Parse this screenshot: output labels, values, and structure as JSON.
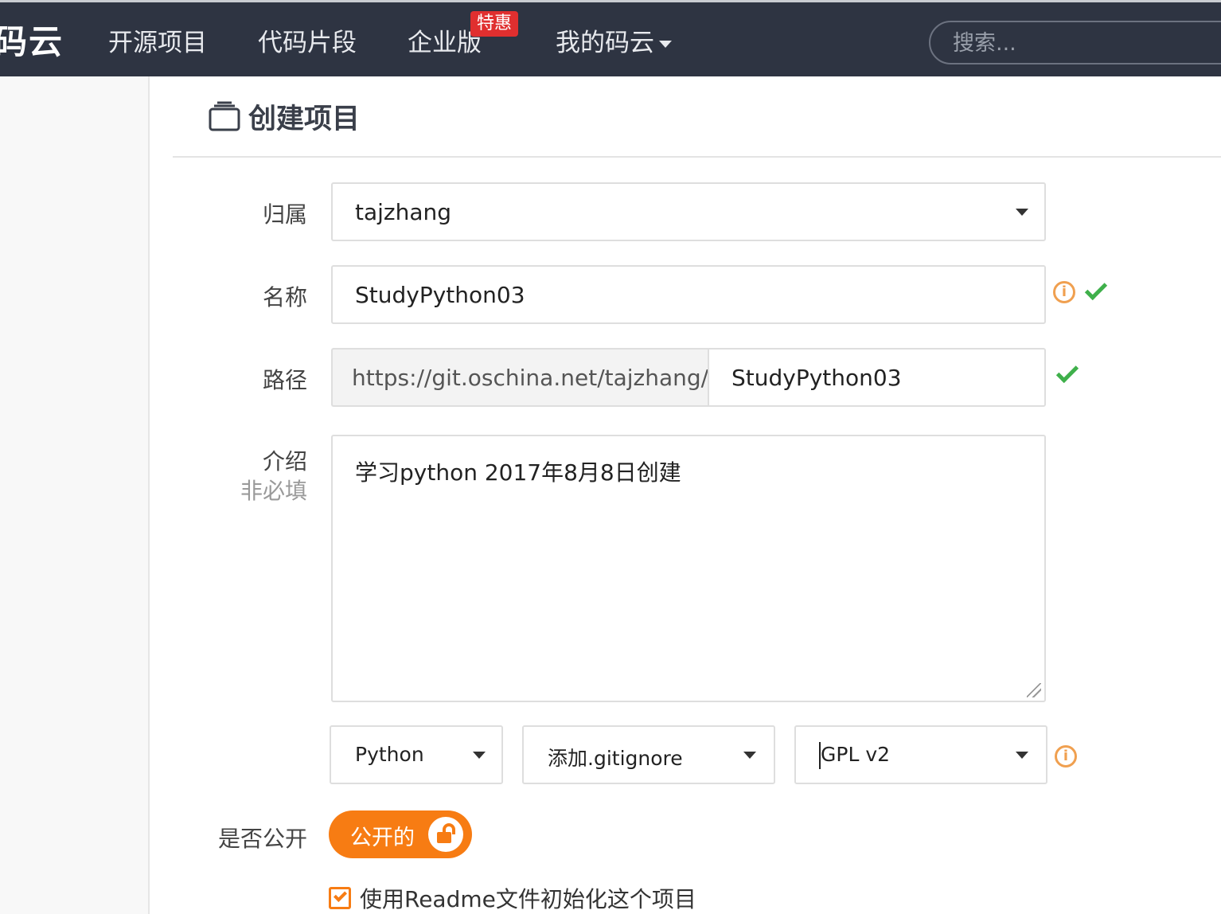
{
  "nav": {
    "logo": "码云",
    "items": [
      "开源项目",
      "代码片段",
      "企业版",
      "我的码云"
    ],
    "badge": "特惠",
    "search_placeholder": "搜索..."
  },
  "page": {
    "title": "创建项目"
  },
  "form": {
    "owner": {
      "label": "归属",
      "value": "tajzhang"
    },
    "name": {
      "label": "名称",
      "value": "StudyPython03"
    },
    "path": {
      "label": "路径",
      "prefix": "https://git.oschina.net/tajzhang/",
      "value": "StudyPython03"
    },
    "description": {
      "label": "介绍",
      "sublabel": "非必填",
      "value": "学习python 2017年8月8日创建"
    },
    "language": {
      "value": "Python"
    },
    "gitignore": {
      "value": "添加.gitignore"
    },
    "license": {
      "value": "GPL v2"
    },
    "visibility": {
      "label": "是否公开",
      "toggle_label": "公开的",
      "is_public": true
    },
    "readme": {
      "label": "使用Readme文件初始化这个项目",
      "checked": true
    }
  },
  "colors": {
    "nav_bg": "#2e3442",
    "accent_orange": "#f77c13",
    "success_green": "#3fb04b",
    "info_orange": "#f0a050",
    "badge_red": "#e02f2f"
  },
  "icons": [
    "repo-icon",
    "info-icon",
    "check-icon",
    "unlock-icon",
    "chevron-down-icon"
  ]
}
